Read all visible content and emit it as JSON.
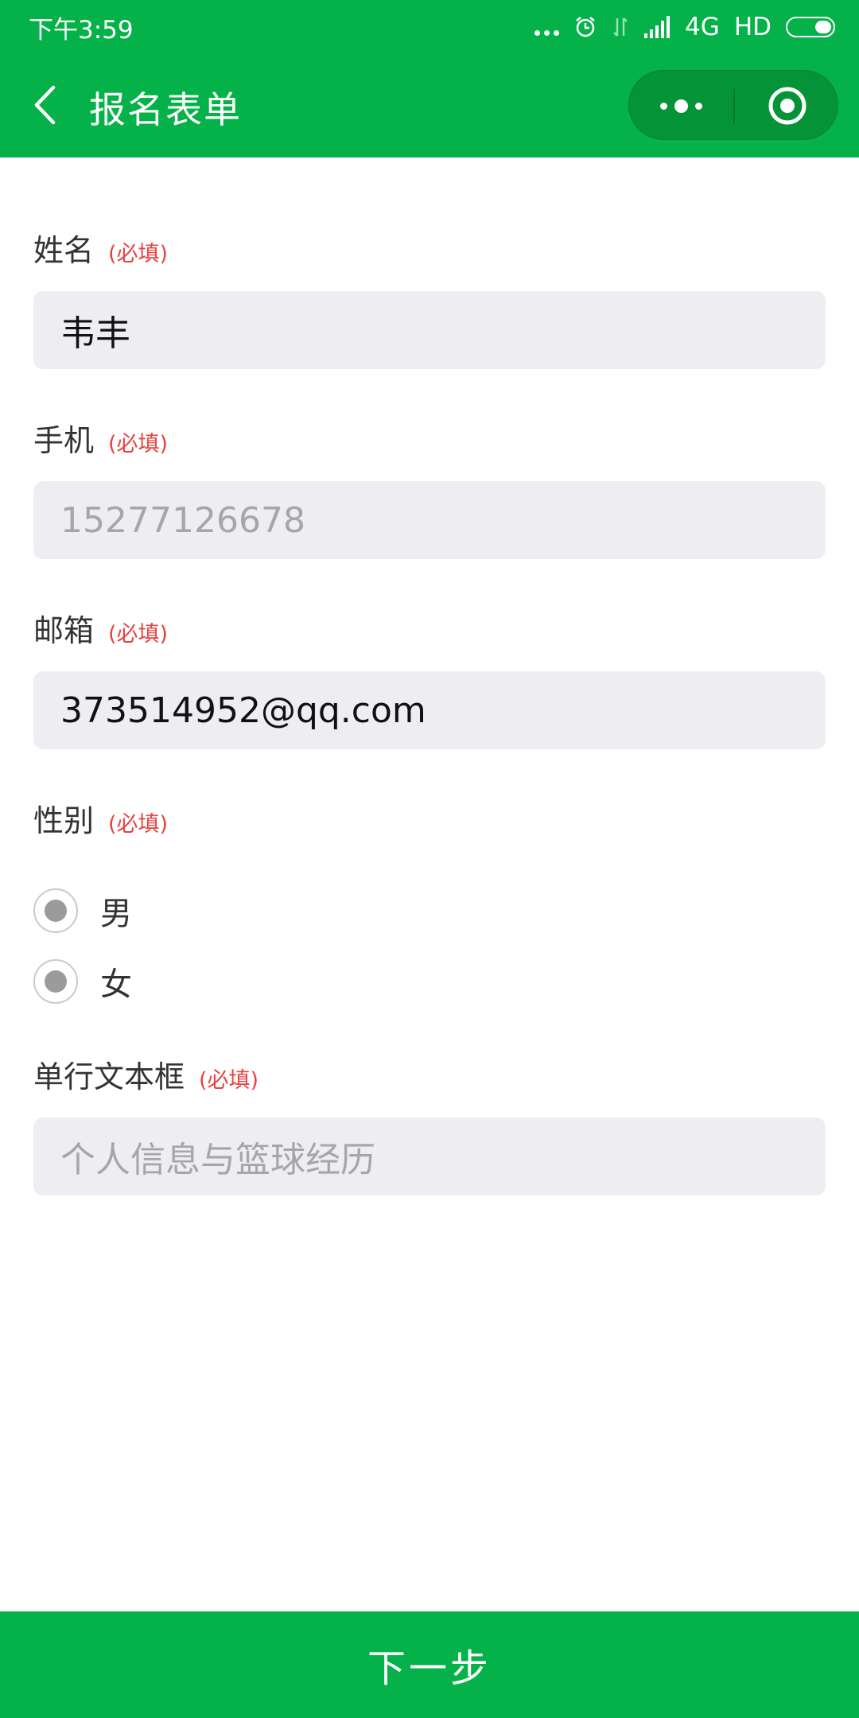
{
  "status_bar": {
    "time": "下午3:59",
    "network": "4G",
    "hd": "HD"
  },
  "nav": {
    "title": "报名表单",
    "back_icon": "chevron-left-icon",
    "more_icon": "more-dots-icon",
    "close_icon": "target-circle-icon"
  },
  "required_text": "(必填)",
  "form": {
    "name": {
      "label": "姓名",
      "required": "(必填)",
      "value": "韦丰"
    },
    "phone": {
      "label": "手机",
      "required": "(必填)",
      "placeholder": "15277126678"
    },
    "email": {
      "label": "邮箱",
      "required": "(必填)",
      "value": "373514952@qq.com"
    },
    "gender": {
      "label": "性别",
      "required": "(必填)",
      "options": [
        {
          "label": "男"
        },
        {
          "label": "女"
        }
      ]
    },
    "text": {
      "label": "单行文本框",
      "required": "(必填)",
      "placeholder": "个人信息与篮球经历"
    }
  },
  "footer": {
    "next_label": "下一步"
  },
  "colors": {
    "brand_green": "#05b249",
    "required_red": "#e64340",
    "input_bg": "#eeeef2"
  }
}
